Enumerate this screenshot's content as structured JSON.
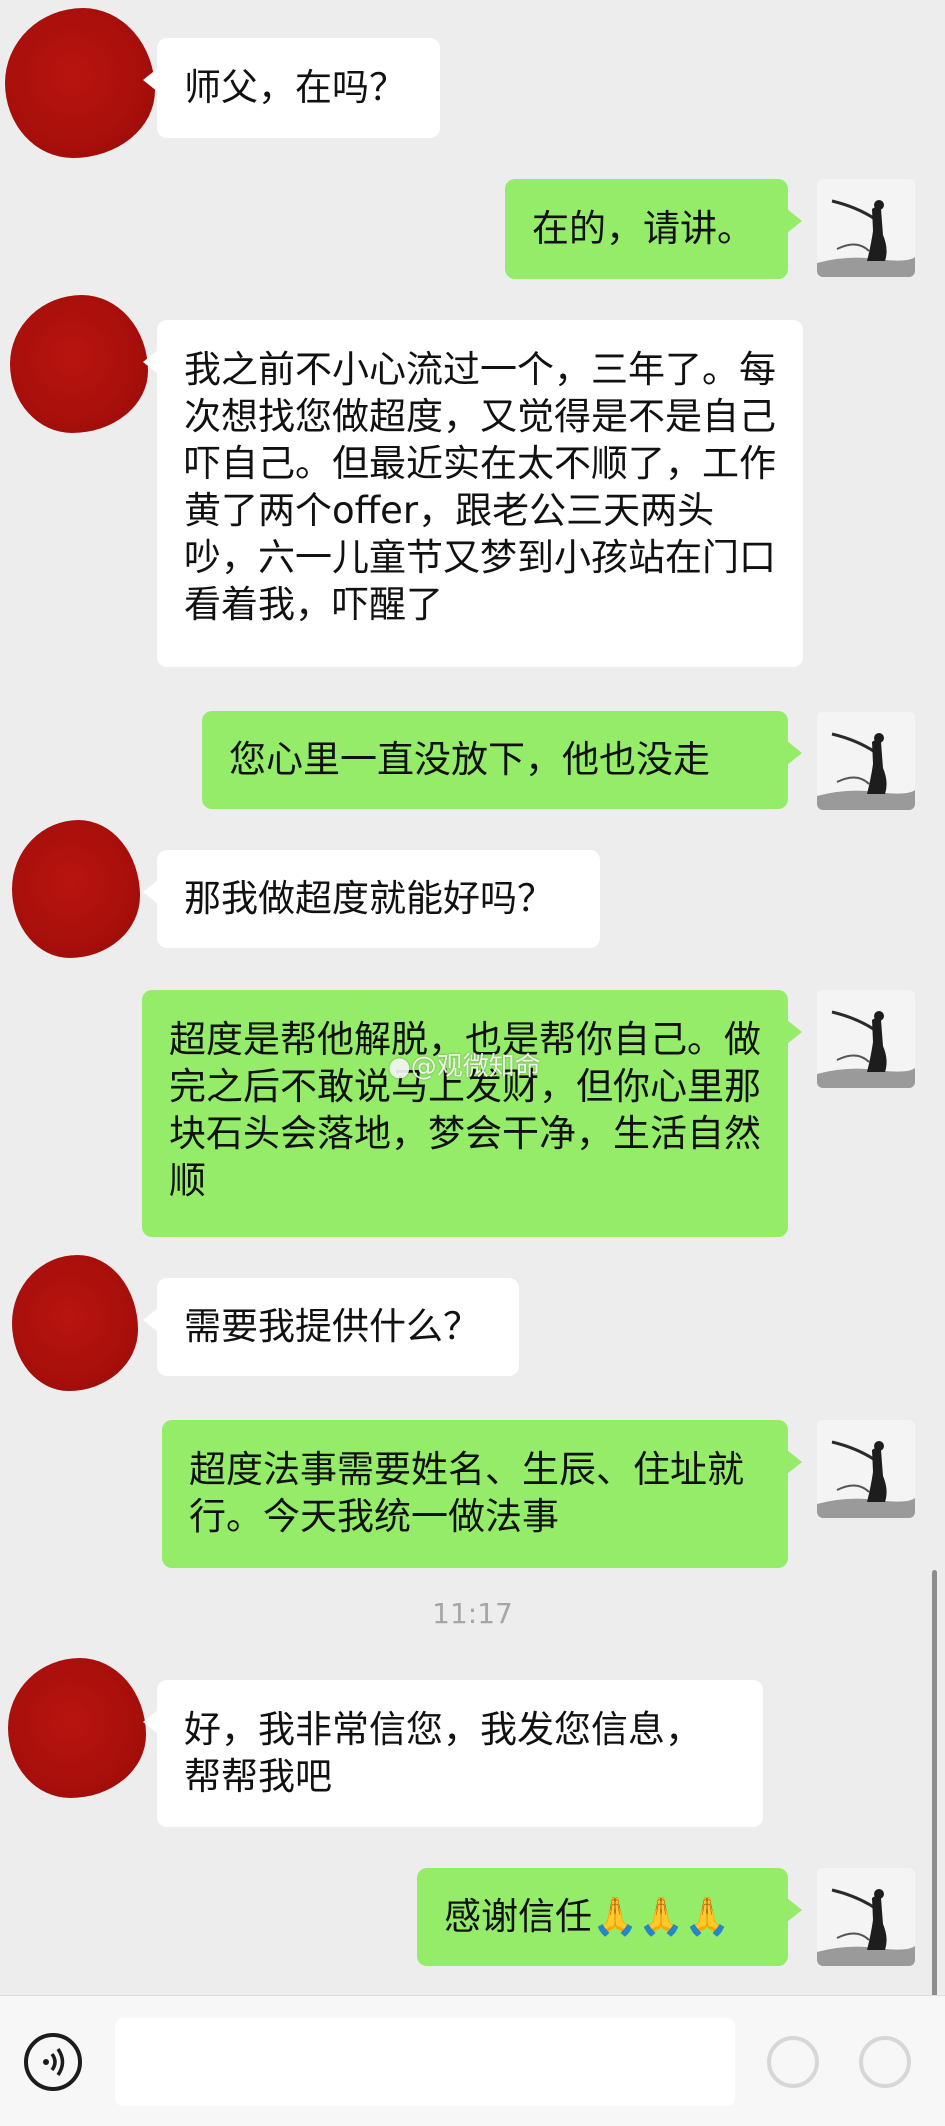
{
  "messages": [
    {
      "side": "in",
      "text": "师父，在吗？"
    },
    {
      "side": "out",
      "text": "在的，请讲。"
    },
    {
      "side": "in",
      "text": "我之前不小心流过一个，三年了。每次想找您做超度，又觉得是不是自己吓自己。但最近实在太不顺了，工作黄了两个offer，跟老公三天两头吵，六一儿童节又梦到小孩站在门口看着我，吓醒了"
    },
    {
      "side": "out",
      "text": "您心里一直没放下，他也没走"
    },
    {
      "side": "in",
      "text": "那我做超度就能好吗？"
    },
    {
      "side": "out",
      "text": "超度是帮他解脱，也是帮你自己。做完之后不敢说马上发财，但你心里那块石头会落地，梦会干净，生活自然顺"
    },
    {
      "side": "in",
      "text": "需要我提供什么？"
    },
    {
      "side": "out",
      "text": "超度法事需要姓名、生辰、住址就行。今天我统一做法事"
    },
    {
      "side": "in",
      "text": "好，我非常信您，我发您信息，帮帮我吧"
    },
    {
      "side": "out",
      "text": "感谢信任🙏🙏🙏"
    }
  ],
  "timestamp": "11:17",
  "watermark": "@观微知命",
  "icons": {
    "voice": "voice-input-icon",
    "emoji": "emoji-icon",
    "plus": "plus-icon",
    "watermark": "weibo-logo-icon"
  },
  "colors": {
    "background": "#ededed",
    "outgoing_bubble": "#95ec69",
    "incoming_bubble": "#ffffff",
    "avatar_blot": "#a80f0b"
  }
}
